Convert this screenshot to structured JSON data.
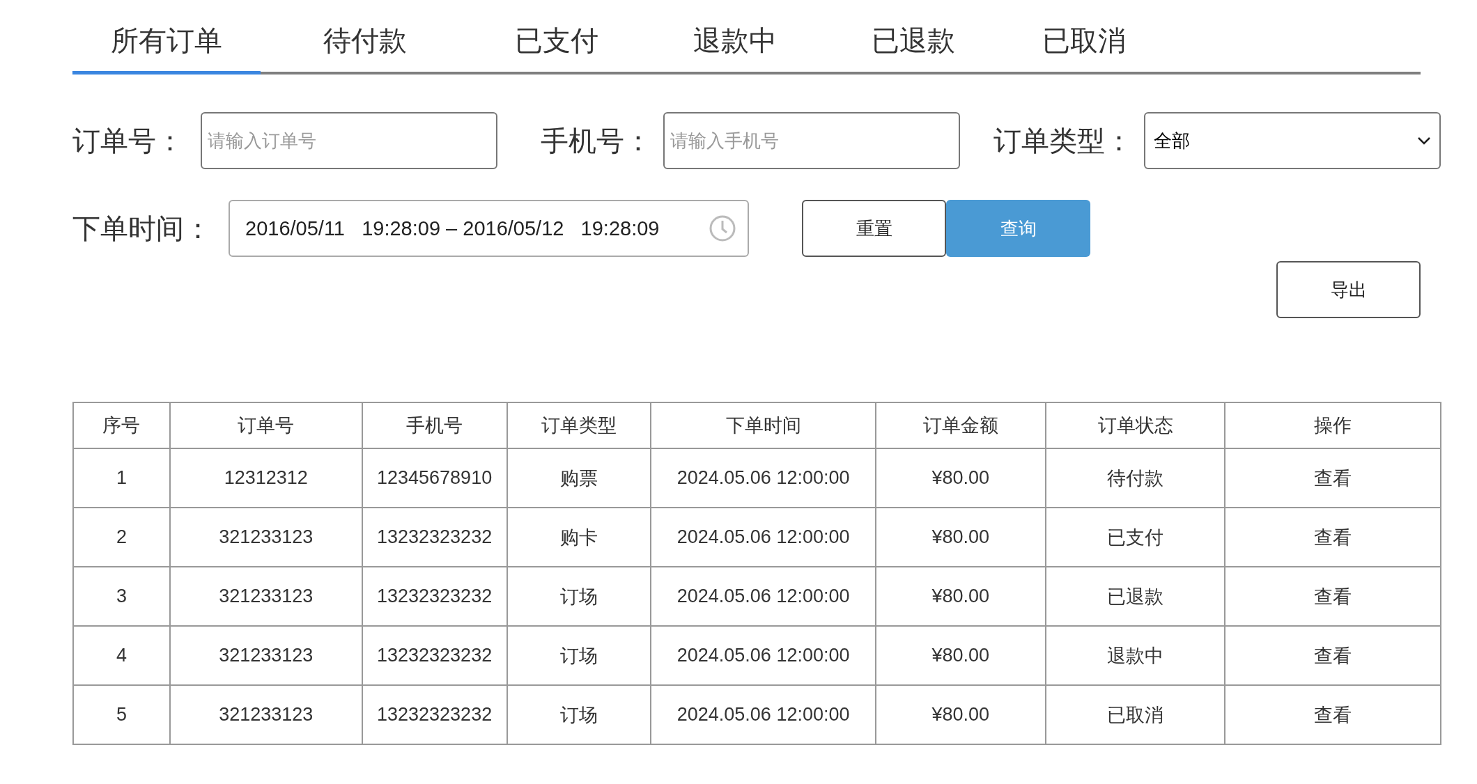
{
  "tabs": [
    {
      "label": "所有订单",
      "selected": true
    },
    {
      "label": "待付款",
      "selected": false
    },
    {
      "label": "已支付",
      "selected": false
    },
    {
      "label": "退款中",
      "selected": false
    },
    {
      "label": "已退款",
      "selected": false
    },
    {
      "label": "已取消",
      "selected": false
    }
  ],
  "filters": {
    "order_no": {
      "label": "订单号：",
      "placeholder": "请输入订单号"
    },
    "phone": {
      "label": "手机号：",
      "placeholder": "请输入手机号"
    },
    "order_type": {
      "label": "订单类型：",
      "value": "全部"
    },
    "order_time": {
      "label": "下单时间：",
      "value": "2016/05/11   19:28:09 – 2016/05/12   19:28:09"
    }
  },
  "buttons": {
    "reset": "重置",
    "query": "查询",
    "export": "导出"
  },
  "table": {
    "columns": [
      "序号",
      "订单号",
      "手机号",
      "订单类型",
      "下单时间",
      "订单金额",
      "订单状态",
      "操作"
    ],
    "rows": [
      [
        "1",
        "12312312",
        "12345678910",
        "购票",
        "2024.05.06 12:00:00",
        "¥80.00",
        "待付款",
        "查看"
      ],
      [
        "2",
        "321233123",
        "13232323232",
        "购卡",
        "2024.05.06 12:00:00",
        "¥80.00",
        "已支付",
        "查看"
      ],
      [
        "3",
        "321233123",
        "13232323232",
        "订场",
        "2024.05.06 12:00:00",
        "¥80.00",
        "已退款",
        "查看"
      ],
      [
        "4",
        "321233123",
        "13232323232",
        "订场",
        "2024.05.06 12:00:00",
        "¥80.00",
        "退款中",
        "查看"
      ],
      [
        "5",
        "321233123",
        "13232323232",
        "订场",
        "2024.05.06 12:00:00",
        "¥80.00",
        "已取消",
        "查看"
      ]
    ]
  }
}
